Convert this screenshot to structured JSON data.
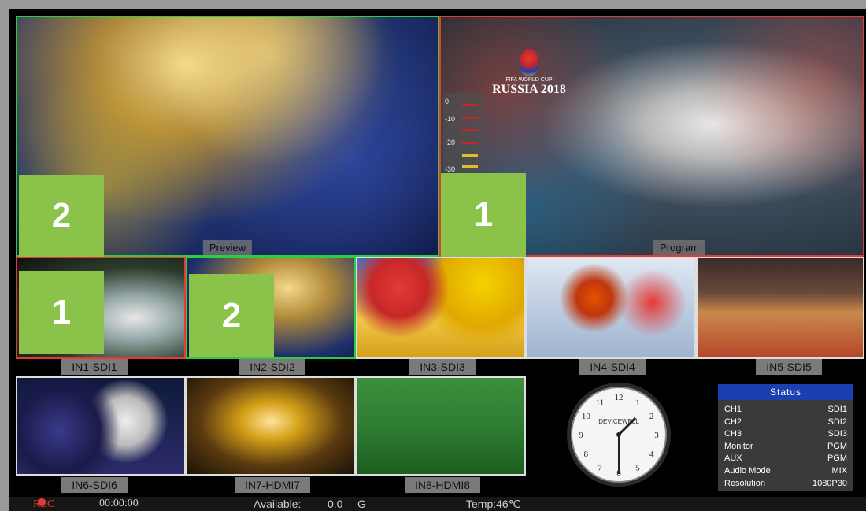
{
  "preview": {
    "label": "Preview",
    "tally": "2"
  },
  "program": {
    "label": "Program",
    "tally": "1",
    "overlay_brand_line1": "FIFA WORLD CUP",
    "overlay_brand_line2": "RUSSIA 2018"
  },
  "audio_meter": {
    "ticks": [
      "0",
      "-10",
      "-20",
      "-30"
    ]
  },
  "inputs": [
    {
      "label": "IN1-SDI1",
      "tally": "1"
    },
    {
      "label": "IN2-SDI2",
      "tally": "2"
    },
    {
      "label": "IN3-SDI3"
    },
    {
      "label": "IN4-SDI4"
    },
    {
      "label": "IN5-SDI5"
    },
    {
      "label": "IN6-SDI6"
    },
    {
      "label": "IN7-HDMI7"
    },
    {
      "label": "IN8-HDMI8"
    }
  ],
  "clock": {
    "brand": "DEVICEWELL",
    "numbers": [
      "12",
      "1",
      "2",
      "3",
      "4",
      "5",
      "6",
      "7",
      "8",
      "9",
      "10",
      "11"
    ],
    "hour": 1,
    "minute": 30
  },
  "status": {
    "title": "Status",
    "rows": [
      {
        "key": "CH1",
        "value": "SDI1"
      },
      {
        "key": "CH2",
        "value": "SDI2"
      },
      {
        "key": "CH3",
        "value": "SDI3"
      },
      {
        "key": "Monitor",
        "value": "PGM"
      },
      {
        "key": "AUX",
        "value": "PGM"
      },
      {
        "key": "Audio Mode",
        "value": "MIX"
      },
      {
        "key": "Resolution",
        "value": "1080P30"
      }
    ]
  },
  "statusbar": {
    "rec": "REC",
    "timecode": "00:00:00",
    "available_label": "Available:",
    "available_value": "0.0",
    "available_unit": "G",
    "temp": "Temp:46℃"
  },
  "colors": {
    "tally": "#8bc34a",
    "preview_border": "#2ecc40",
    "program_border": "#e53935",
    "status_head": "#1a3fb0"
  }
}
